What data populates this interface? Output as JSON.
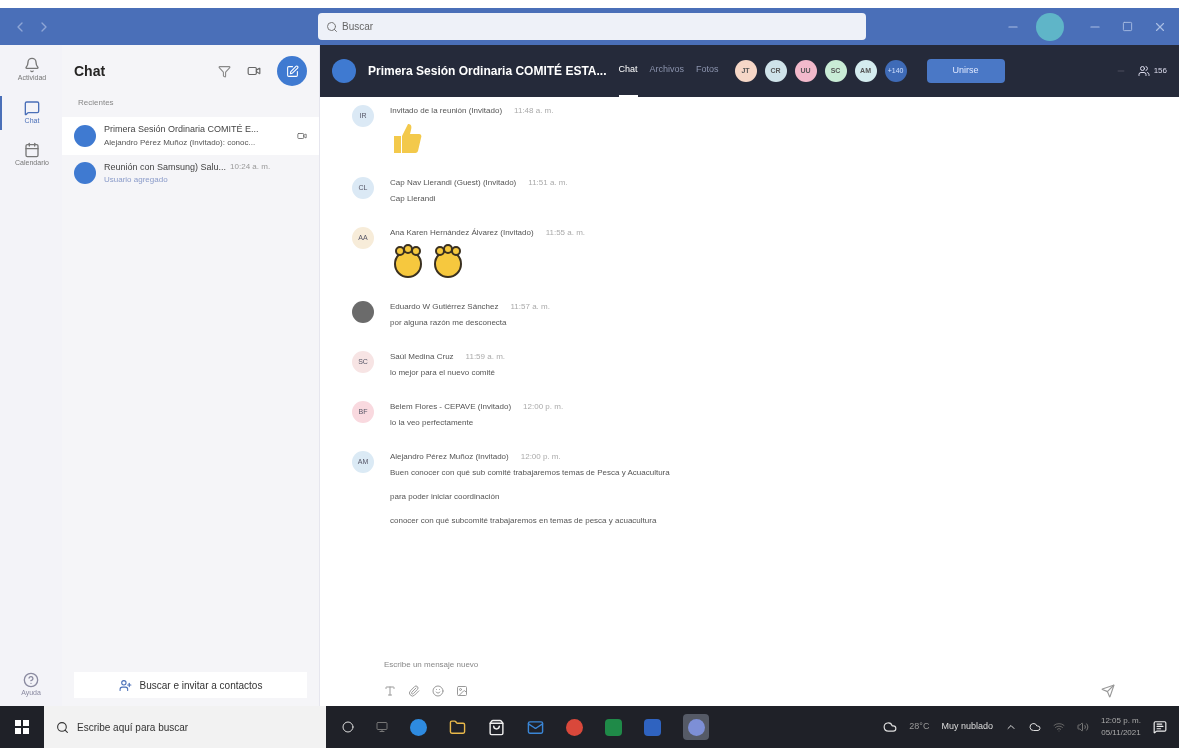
{
  "titlebar": {
    "search_placeholder": "Buscar"
  },
  "rail": [
    {
      "label": "Actividad",
      "selected": false
    },
    {
      "label": "Chat",
      "selected": true
    },
    {
      "label": "Calendario",
      "selected": false
    }
  ],
  "rail_bottom": {
    "label": "Ayuda"
  },
  "chat_list": {
    "title": "Chat",
    "section": "Recientes",
    "items": [
      {
        "title": "Primera Sesión Ordinaria COMITÉ E...",
        "subtitle": "Alejandro Pérez Muñoz (Invitado): conoc...",
        "selected": true,
        "meeting": true
      },
      {
        "title": "Reunión con Samsung) Salu...",
        "subtitle": "Usuario agregado",
        "time": "10:24 a. m.",
        "selected": false,
        "meeting": false
      }
    ],
    "invite": "Buscar e invitar a contactos"
  },
  "conversation": {
    "title": "Primera Sesión Ordinaria COMITÉ ESTA...",
    "tabs": [
      {
        "label": "Chat",
        "selected": true
      },
      {
        "label": "Archivos",
        "selected": false
      },
      {
        "label": "Fotos",
        "selected": false
      }
    ],
    "participants": [
      {
        "initials": "JT",
        "color": "#f6d7c7"
      },
      {
        "initials": "CR",
        "color": "#cfe3ea"
      },
      {
        "initials": "UU",
        "color": "#f2b9cb"
      },
      {
        "initials": "SC",
        "color": "#c9ecd6"
      },
      {
        "initials": "AM",
        "color": "#d4ecef"
      }
    ],
    "more_participants": "+140",
    "join": "Unirse",
    "people_count": "156",
    "messages": [
      {
        "avatar": {
          "kind": "initials",
          "text": "IR",
          "color": "#dbe9f5"
        },
        "author": "Invitado de la reunión (Invitado)",
        "time": "11:48 a. m.",
        "reactions": [
          {
            "kind": "thumbs"
          }
        ]
      },
      {
        "avatar": {
          "kind": "initials",
          "text": "CL",
          "color": "#dbe9f5"
        },
        "author": "Cap Nav Llerandi (Guest) (Invitado)",
        "time": "11:51 a. m.",
        "lines": [
          "Cap Llerandi"
        ]
      },
      {
        "avatar": {
          "kind": "initials",
          "text": "AA",
          "color": "#f7ecd9"
        },
        "author": "Ana Karen Hernández Álvarez (Invitado)",
        "time": "11:55 a. m.",
        "reactions": [
          {
            "kind": "clap"
          },
          {
            "kind": "clap"
          }
        ]
      },
      {
        "avatar": {
          "kind": "photo"
        },
        "author": "Eduardo W Gutiérrez Sánchez",
        "time": "11:57 a. m.",
        "lines": [
          "por alguna razón me desconecta"
        ]
      },
      {
        "avatar": {
          "kind": "initials",
          "text": "SC",
          "color": "#f7e4e4"
        },
        "author": "Saúl Medina Cruz",
        "time": "11:59 a. m.",
        "lines": [
          "lo mejor para el nuevo comité"
        ]
      },
      {
        "avatar": {
          "kind": "initials",
          "text": "BF",
          "color": "#f9d9df"
        },
        "author": "Belem Flores - CEPAVE (Invitado)",
        "time": "12:00 p. m.",
        "lines": [
          "lo la veo perfectamente"
        ]
      },
      {
        "avatar": {
          "kind": "initials",
          "text": "AM",
          "color": "#dbeaf5"
        },
        "author": "Alejandro Pérez Muñoz (Invitado)",
        "time": "12:00 p. m.",
        "lines": [
          "Buen conocer con qué sub comité trabajaremos temas de Pesca y Acuacultura",
          "para poder iniciar coordinación",
          "conocer con qué subcomité trabajaremos en temas de pesca y acuacultura"
        ]
      }
    ],
    "compose_placeholder": "Escribe un mensaje nuevo"
  },
  "taskbar": {
    "search_placeholder": "Escribe aquí para buscar",
    "weather": "28°C",
    "weather_text": "Muy nublado",
    "time": "12:05 p. m.",
    "date": "05/11/2021"
  }
}
